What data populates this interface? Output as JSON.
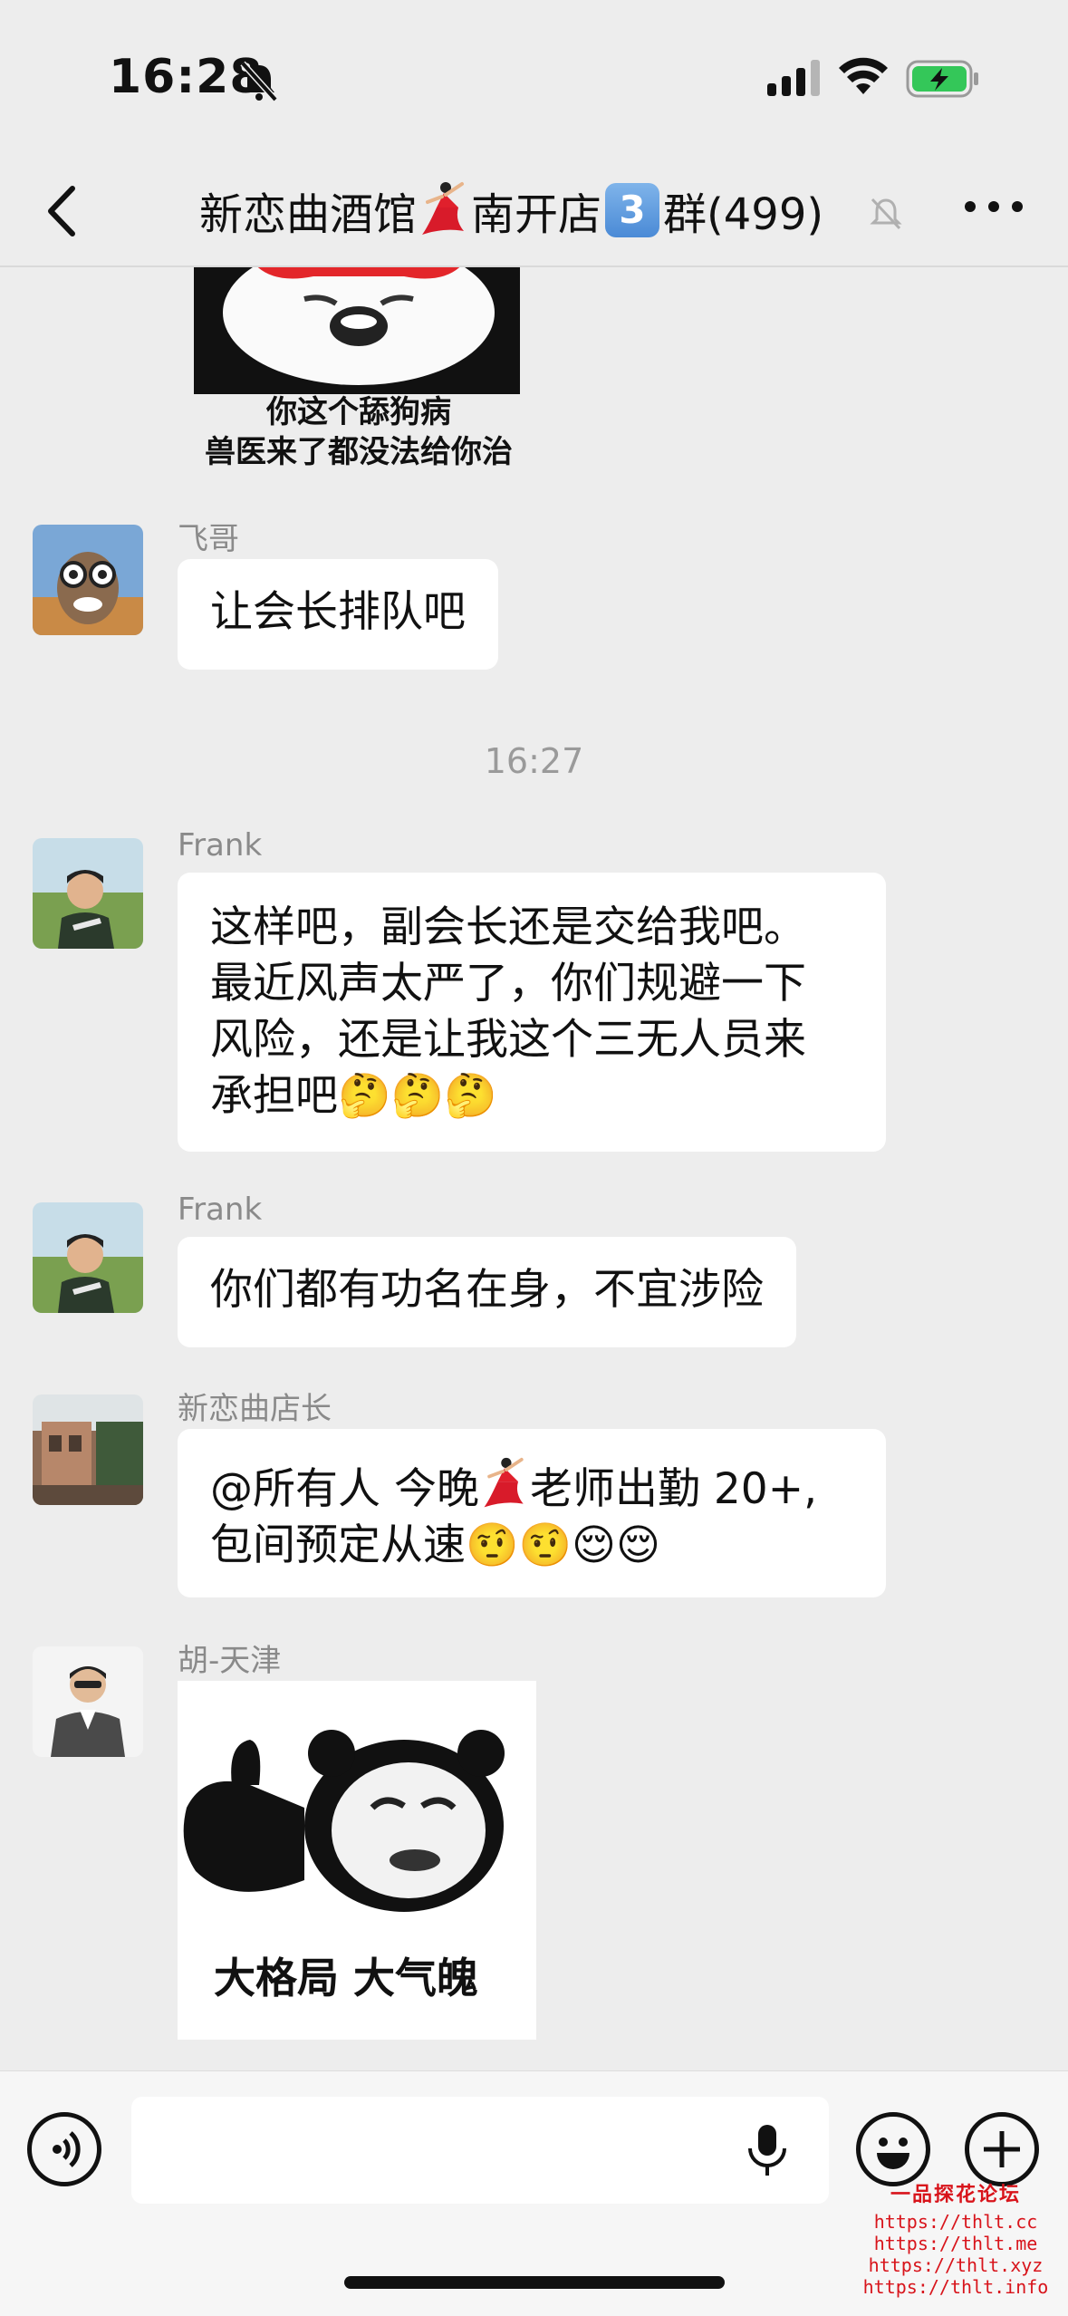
{
  "status_bar": {
    "time": "16:28"
  },
  "nav": {
    "title_prefix": "新恋曲酒馆",
    "title_mid": "南开店",
    "keycap": "3",
    "title_suffix": "群(499)"
  },
  "messages": {
    "sticker1": {
      "caption_line1": "你这个舔狗病",
      "caption_line2": "兽医来了都没法给你治"
    },
    "msg1": {
      "sender": "飞哥",
      "text": "让会长排队吧"
    },
    "timestamp": "16:27",
    "msg2": {
      "sender": "Frank",
      "line1": "这样吧，副会长还是交给我吧。",
      "line2": "最近风声太严了，你们规避一下",
      "line3": "风险，还是让我这个三无人员来",
      "line4": "承担吧🤔🤔🤔"
    },
    "msg3": {
      "sender": "Frank",
      "text": "你们都有功名在身，不宜涉险"
    },
    "msg4": {
      "sender": "新恋曲店长",
      "line1_a": "@所有人 今晚",
      "line1_b": "老师出勤 20+,",
      "line2": "包间预定从速🤨🤨😌😌"
    },
    "msg5": {
      "sender": "胡-天津",
      "caption": "大格局 大气魄"
    }
  },
  "watermark": {
    "title": "一品探花论坛",
    "urls": [
      "https://thlt.cc",
      "https://thlt.me",
      "https://thlt.xyz",
      "https://thlt.info"
    ]
  },
  "colors": {
    "background": "#ededed",
    "bubble": "#ffffff",
    "battery": "#34c759",
    "watermark": "#d8141b"
  }
}
